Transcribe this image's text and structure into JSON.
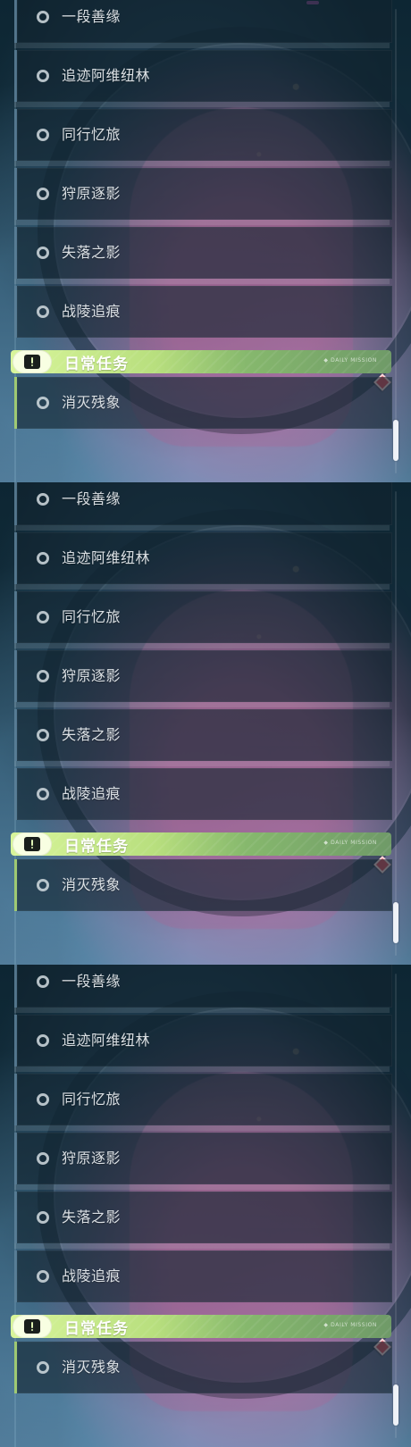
{
  "quest_list": {
    "items": [
      {
        "label": "一段善缘"
      },
      {
        "label": "追迹阿维纽林"
      },
      {
        "label": "同行忆旅"
      },
      {
        "label": "狩原逐影"
      },
      {
        "label": "失落之影"
      },
      {
        "label": "战陵追痕"
      }
    ],
    "section": {
      "title": "日常任务",
      "tag": "◆ DAILY MISSION",
      "icon": "exclamation-icon"
    },
    "daily_items": [
      {
        "label": "消灭残象"
      }
    ]
  },
  "ui": {
    "accent_green": "#b8df7e",
    "marker_red": "#e05464"
  }
}
